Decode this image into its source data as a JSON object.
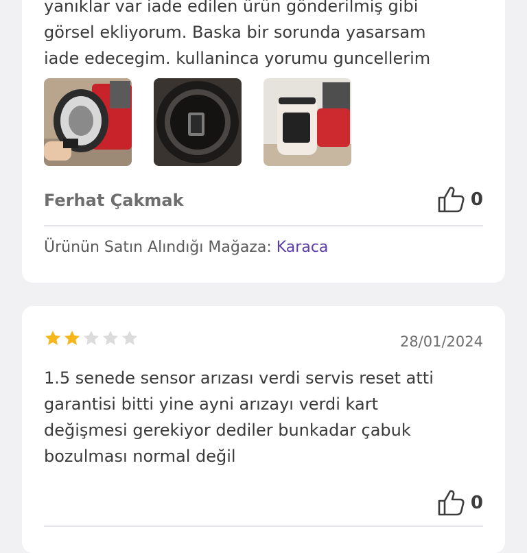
{
  "reviews": [
    {
      "text_lines": "yanıklar var iade edilen ürün gönderilmiş gibi\ngörsel ekliyorum. Baska bir sorunda yasarsam\niade edecegim. kullaninca yorumu guncellerim",
      "author": "Ferhat Çakmak",
      "likes": "0",
      "store_label": "Ürünün Satın Alındığı Mağaza:",
      "store_name": "Karaca",
      "photos": [
        "review-photo-1",
        "review-photo-2",
        "review-photo-3"
      ]
    },
    {
      "rating": 2,
      "rating_max": 5,
      "date": "28/01/2024",
      "text_lines": "1.5 senede sensor arızası verdi servis reset atti\ngarantisi bitti yine ayni arızayı verdi kart\ndeğişmesi gerekiyor dediler bunkadar çabuk\nbozulması normal değil",
      "likes": "0"
    }
  ],
  "colors": {
    "star_filled": "#f6b71e",
    "star_empty": "#dcdcdc",
    "store_link": "#5b3fa6"
  }
}
